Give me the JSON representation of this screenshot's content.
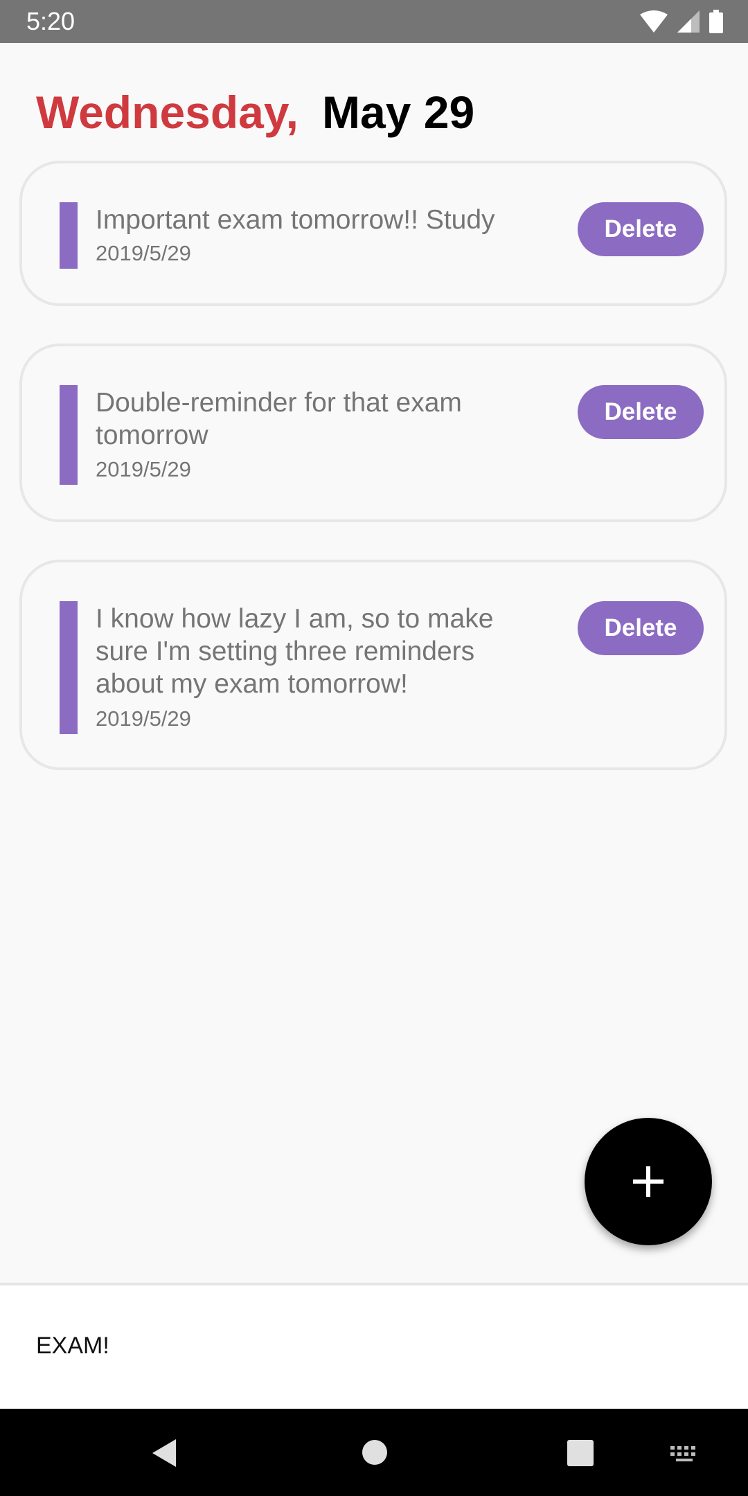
{
  "status_bar": {
    "time": "5:20"
  },
  "header": {
    "weekday": "Wednesday,",
    "date": "May 29"
  },
  "reminders": [
    {
      "text": "Important exam tomorrow!! Study",
      "date": "2019/5/29",
      "delete_label": "Delete"
    },
    {
      "text": "Double-reminder for that exam tomorrow",
      "date": "2019/5/29",
      "delete_label": "Delete"
    },
    {
      "text": "I know how lazy I am, so to make sure I'm setting three reminders about my exam tomorrow!",
      "date": "2019/5/29",
      "delete_label": "Delete"
    }
  ],
  "fab": {
    "icon": "plus-icon"
  },
  "input": {
    "value": "EXAM!"
  },
  "nav": {
    "icons": [
      "back-icon",
      "home-icon",
      "recents-icon",
      "keyboard-icon"
    ]
  },
  "colors": {
    "accent": "#8c6bc2",
    "weekday": "#cf3a3f",
    "status_bar": "#757575"
  }
}
